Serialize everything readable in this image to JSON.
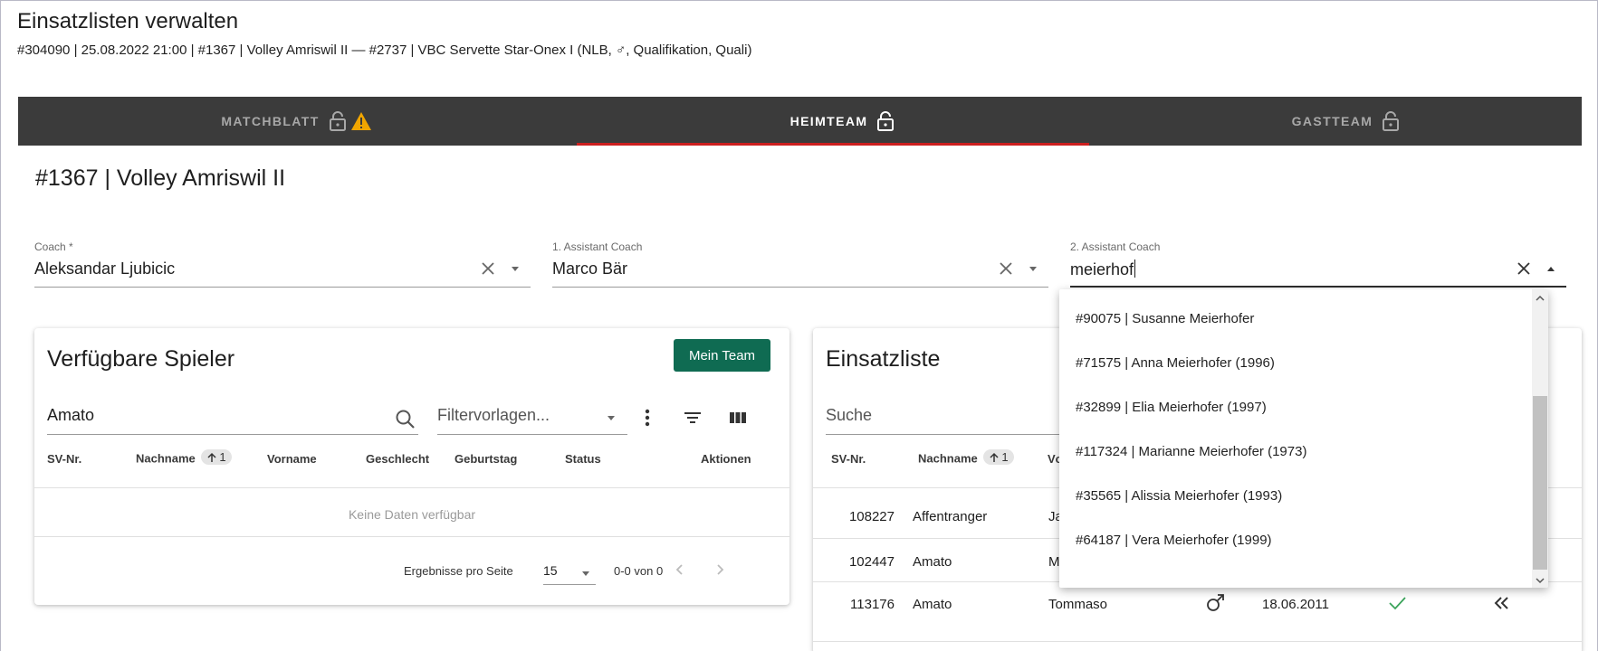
{
  "header": {
    "title": "Einsatzlisten verwalten",
    "subtitle": "#304090 | 25.08.2022 21:00 | #1367 | Volley Amriswil II — #2737 | VBC Servette Star-Onex I (NLB, ♂, Qualifikation, Quali)"
  },
  "tabs": {
    "matchblatt": "MATCHBLATT",
    "heimteam": "HEIMTEAM",
    "gastteam": "GASTTEAM",
    "active": "heimteam"
  },
  "team_title": "#1367 | Volley Amriswil II",
  "coaches": {
    "coach": {
      "label": "Coach *",
      "value": "Aleksandar Ljubicic"
    },
    "assistant1": {
      "label": "1. Assistant Coach",
      "value": "Marco Bär"
    },
    "assistant2": {
      "label": "2. Assistant Coach",
      "value": "meierhof"
    }
  },
  "dropdown_options": [
    "#90075 | Susanne Meierhofer",
    "#71575 | Anna Meierhofer (1996)",
    "#32899 | Elia Meierhofer (1997)",
    "#117324 | Marianne Meierhofer (1973)",
    "#35565 | Alissia Meierhofer (1993)",
    "#64187 | Vera Meierhofer (1999)"
  ],
  "available_players": {
    "title": "Verfügbare Spieler",
    "mein_team_button": "Mein Team",
    "search_value": "Amato",
    "filter_placeholder": "Filtervorlagen...",
    "columns": {
      "sv_nr": "SV-Nr.",
      "nachname": "Nachname",
      "sort_index": "1",
      "vorname": "Vorname",
      "geschlecht": "Geschlecht",
      "geburtstag": "Geburtstag",
      "status": "Status",
      "aktionen": "Aktionen"
    },
    "empty_text": "Keine Daten verfügbar",
    "pager": {
      "per_page_label": "Ergebnisse pro Seite",
      "per_page_value": "15",
      "range": "0-0 von 0"
    }
  },
  "lineup": {
    "title": "Einsatzliste",
    "search_placeholder": "Suche",
    "columns": {
      "sv_nr": "SV-Nr.",
      "nachname": "Nachname",
      "sort_index": "1",
      "vorname_partial": "Vc"
    },
    "rows": [
      {
        "sv_nr": "108227",
        "nachname": "Affentranger",
        "vorname": "Ja"
      },
      {
        "sv_nr": "102447",
        "nachname": "Amato",
        "vorname": "M"
      },
      {
        "sv_nr": "113176",
        "nachname": "Amato",
        "vorname": "Tommaso",
        "geburtstag": "18.06.2011"
      }
    ]
  },
  "colors": {
    "accent_green": "#0f6b52",
    "tab_bar": "#3b3b3b",
    "active_tab_underline": "#cc1f1f",
    "warning": "#f0a500",
    "check_green": "#3aa35a"
  }
}
